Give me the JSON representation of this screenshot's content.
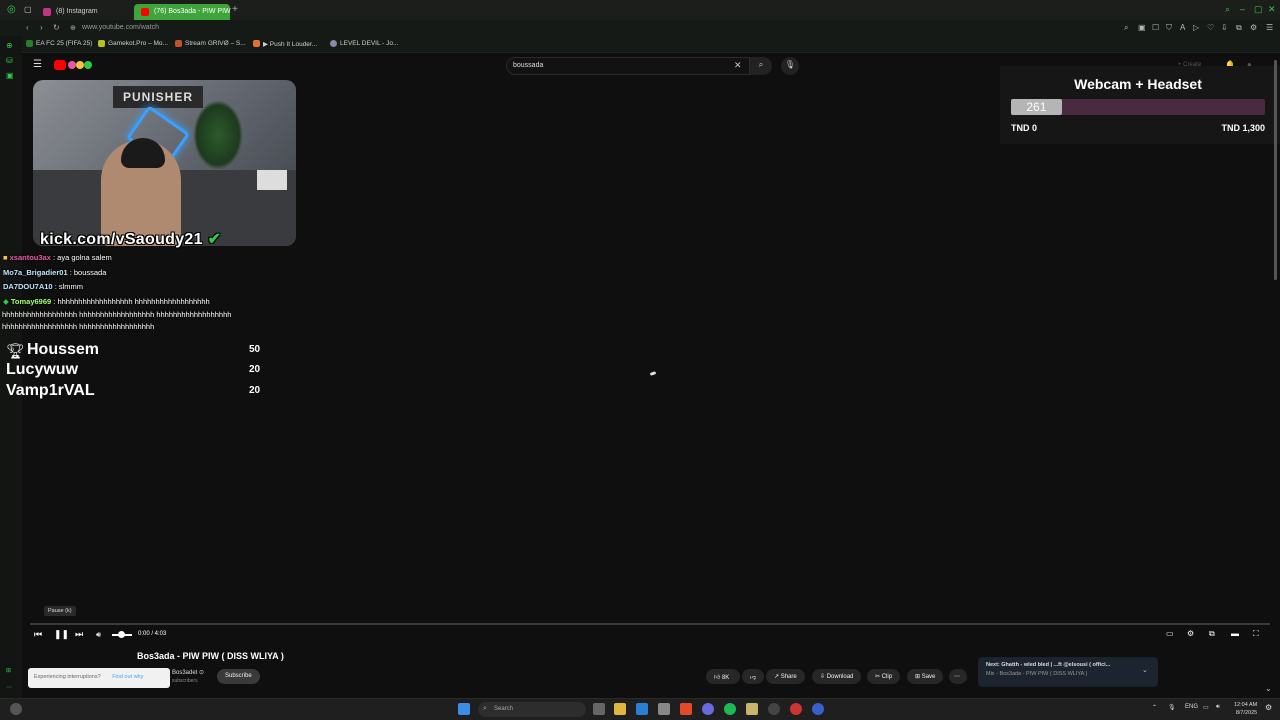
{
  "browser": {
    "tabs": [
      {
        "label": "(8) Instagram",
        "active": false
      },
      {
        "label": "(76) Bos3ada - PIW PIW",
        "active": true
      }
    ],
    "url": "www.youtube.com/watch",
    "bookmarks": [
      "EA FC 25 (FIFA 25)",
      "Gamekot.Pro – Mo...",
      "Stream GRIVØ – S...",
      "▶ Push It Louder...",
      "LEVEL DEVIL - Jo..."
    ]
  },
  "youtube": {
    "search_value": "boussada",
    "create_label": "Create"
  },
  "overlay": {
    "goal_title": "Webcam + Headset",
    "goal_current": "261",
    "goal_progress_fraction": 0.2,
    "goal_min_label": "TND 0",
    "goal_max_label": "TND 1,300",
    "kick_url": "kick.com/vSaoudy21",
    "chat": [
      {
        "user": "xsantou3ax",
        "user_color": "#e85aa0",
        "message": " : aya golna salem"
      },
      {
        "user": "Mo7a_Brigadier01",
        "user_color": "#bfe3ff",
        "message": " : boussada"
      },
      {
        "user": "DA7DOU7A10",
        "user_color": "#ffffff",
        "message": " : slmmm"
      },
      {
        "user": "Tomay6969",
        "user_color": "#a6ff7a",
        "message": " : hhhhhhhhhhhhhhhhhh hhhhhhhhhhhhhhhhhh"
      },
      {
        "user": "",
        "user_color": "#ffffff",
        "message": "hhhhhhhhhhhhhhhhhh hhhhhhhhhhhhhhhhhh hhhhhhhhhhhhhhhhhh"
      },
      {
        "user": "",
        "user_color": "#ffffff",
        "message": "hhhhhhhhhhhhhhhhhh hhhhhhhhhhhhhhhhhh"
      }
    ],
    "leaderboard": [
      {
        "name": "Houssem",
        "score": "50"
      },
      {
        "name": "Lucywuw",
        "score": "20"
      },
      {
        "name": "Vamp1rVAL",
        "score": "20"
      }
    ]
  },
  "player": {
    "tooltip": "Pause (k)",
    "time": "0:00 / 4:03",
    "progress_fraction": 0.0
  },
  "video": {
    "title": "Bos3ada - PIW PIW ( DISS WLIYA )",
    "channel_partial": "Bos3adet",
    "subscribers_partial": "subscribers",
    "subscribe_label": "Subscribe",
    "likes": "8K",
    "share_label": "Share",
    "download_label": "Download",
    "clip_label": "Clip",
    "save_label": "Save",
    "interrupt_text": "Experiencing interruptions?",
    "interrupt_link": "Find out why",
    "next_title": "Next: Ghatth - wled bled | ...ft @elsousi ( offici...",
    "next_sub": "Mix - Bos3ada - PIW PIW ( DISS WLIYA )"
  },
  "taskbar": {
    "search_placeholder": "Search",
    "lang": "ENG",
    "time": "12:04 AM",
    "date": "8/7/2025"
  },
  "colors": {
    "browser_accent": "#2ecc40",
    "goal_bar_bg": "#4a2a3e",
    "goal_bar_fill": "#b5b5b5"
  }
}
